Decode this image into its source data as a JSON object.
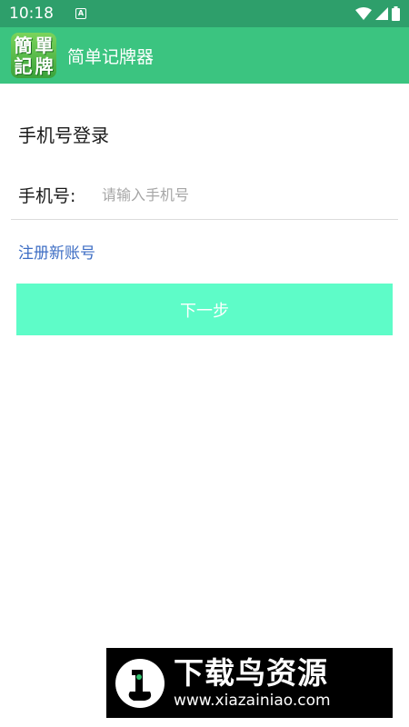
{
  "status_bar": {
    "time": "10:18",
    "notification_glyph": "A",
    "icons": [
      "wifi-icon",
      "cellular-signal-icon",
      "battery-icon"
    ]
  },
  "app_bar": {
    "logo_chars": [
      "簡",
      "單",
      "記",
      "牌"
    ],
    "title": "简单记牌器"
  },
  "login": {
    "title": "手机号登录",
    "phone_label": "手机号:",
    "phone_value": "",
    "phone_placeholder": "请输入手机号",
    "register_link": "注册新账号",
    "next_button": "下一步"
  },
  "watermark": {
    "brand": "下载鸟资源",
    "url": "www.xiazainiao.com"
  },
  "colors": {
    "status_bar": "#2e9f6b",
    "app_bar": "#3bc480",
    "link": "#3e6ec4",
    "button": "#5efcc8"
  }
}
